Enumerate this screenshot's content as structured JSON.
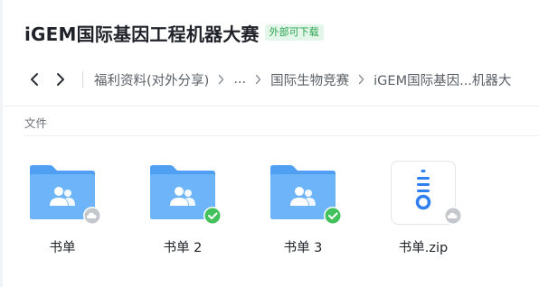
{
  "header": {
    "title": "iGEM国际基因工程机器大赛",
    "badge": "外部可下载"
  },
  "breadcrumb": {
    "items": [
      "福利资料(对外分享)",
      "...",
      "国际生物竞赛",
      "iGEM国际基因...机器大"
    ]
  },
  "section": {
    "label": "文件"
  },
  "files": [
    {
      "name": "书单",
      "type": "shared-folder",
      "status": "cloud-icon"
    },
    {
      "name": "书单 2",
      "type": "shared-folder",
      "status": "synced-check-icon"
    },
    {
      "name": "书单 3",
      "type": "shared-folder",
      "status": "synced-check-icon"
    },
    {
      "name": "书单.zip",
      "type": "zip-file",
      "status": "cloud-icon"
    }
  ],
  "colors": {
    "folder_blue": "#5aa9f5",
    "sync_green": "#43c15c",
    "badge_green": "#2aa44f",
    "zip_blue": "#2f7ff0"
  }
}
